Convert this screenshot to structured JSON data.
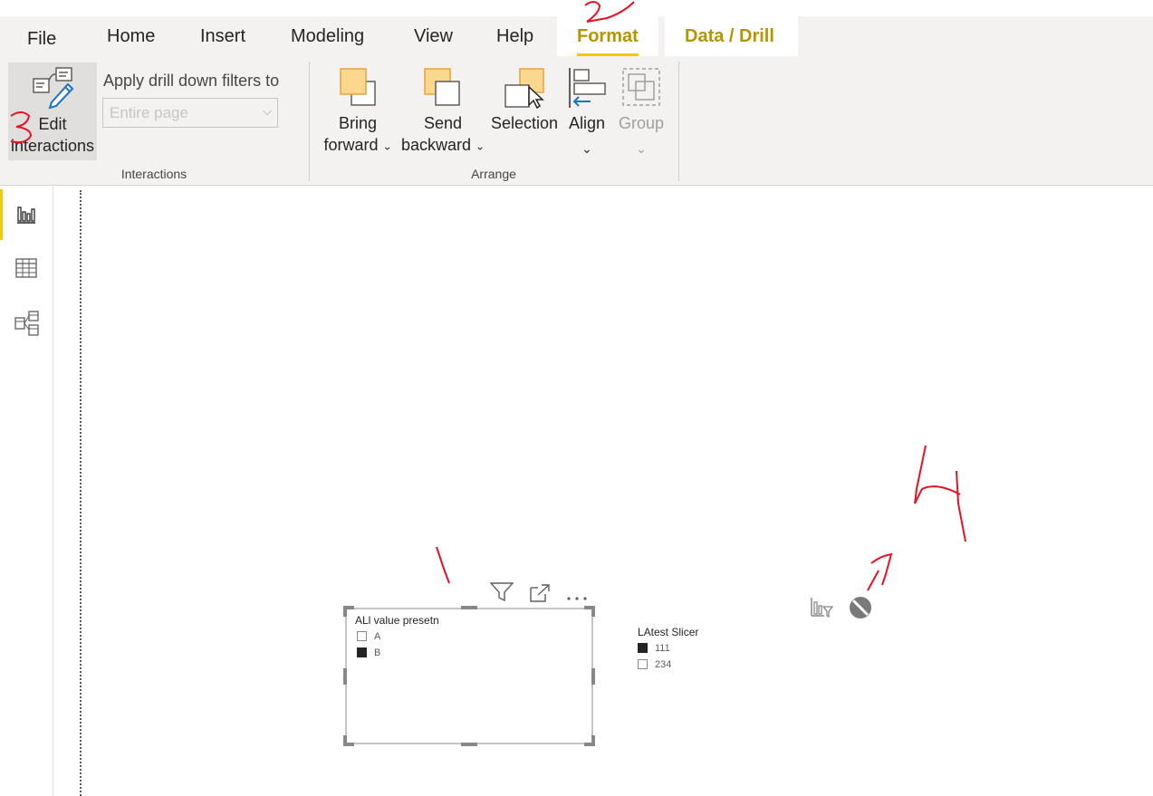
{
  "tabs": {
    "file": "File",
    "home": "Home",
    "insert": "Insert",
    "modeling": "Modeling",
    "view": "View",
    "help": "Help",
    "format": "Format",
    "data_drill": "Data / Drill"
  },
  "ribbon": {
    "edit_interactions": {
      "line1": "Edit",
      "line2": "interactions",
      "icon": "edit-interactions-icon"
    },
    "drill_filters_label": "Apply drill down filters to",
    "drill_filters_value": "Entire page",
    "interactions_group": "Interactions",
    "bring_forward": {
      "line1": "Bring",
      "line2": "forward"
    },
    "send_backward": {
      "line1": "Send",
      "line2": "backward"
    },
    "selection": "Selection",
    "align": "Align",
    "group": "Group",
    "arrange_group": "Arrange"
  },
  "rail": [
    {
      "name": "report-view",
      "icon": "bar-chart-icon",
      "active": true
    },
    {
      "name": "data-view",
      "icon": "table-icon",
      "active": false
    },
    {
      "name": "model-view",
      "icon": "model-icon",
      "active": false
    }
  ],
  "visuals": {
    "slicer1": {
      "title": "ALl value presetn",
      "options": [
        {
          "label": "A",
          "checked": false
        },
        {
          "label": "B",
          "checked": true
        }
      ]
    },
    "slicer2": {
      "title": "LAtest Slicer",
      "options": [
        {
          "label": "111",
          "checked": true
        },
        {
          "label": "234",
          "checked": false
        }
      ]
    }
  },
  "colors": {
    "accent": "#f2c811",
    "active_tab_text": "#b59600",
    "annotation": "#e81123"
  },
  "annotations": [
    "1",
    "2",
    "3",
    "4",
    "7"
  ]
}
